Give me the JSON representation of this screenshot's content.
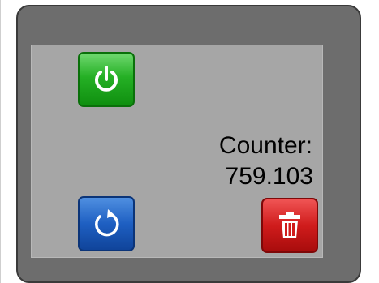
{
  "panel": {
    "counter_label": "Counter:",
    "counter_value": "759.103"
  },
  "buttons": {
    "power": {
      "icon": "power-icon",
      "color": "#25b025"
    },
    "reset": {
      "icon": "refresh-icon",
      "color": "#1e5fc2"
    },
    "delete": {
      "icon": "trash-icon",
      "color": "#d01c1c"
    }
  },
  "colors": {
    "device_bezel": "#6d6d6d",
    "screen": "#a6a6a6"
  }
}
